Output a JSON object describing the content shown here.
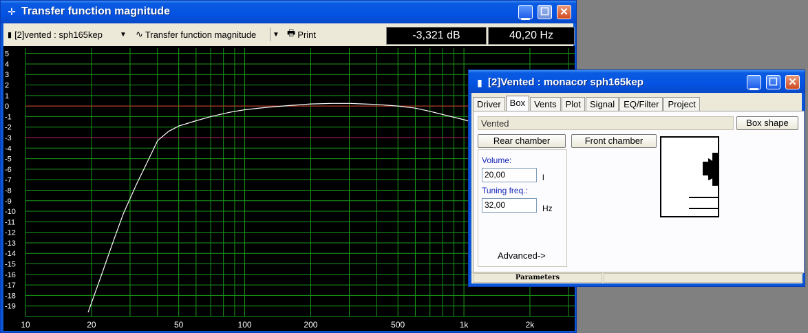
{
  "main_window": {
    "title": "Transfer function magnitude",
    "toolbar": {
      "project_selector": "[2]vented : sph165kep",
      "view_selector": "Transfer function magnitude",
      "print_label": "Print",
      "readout_db": "-3,321 dB",
      "readout_hz": "40,20 Hz"
    }
  },
  "chart_data": {
    "type": "line",
    "xscale": "log",
    "xlim": [
      10,
      3200
    ],
    "ylim": [
      -20,
      5.5
    ],
    "grid": true,
    "x_tick_labels": [
      "10",
      "20",
      "50",
      "100",
      "200",
      "500",
      "1k",
      "2k"
    ],
    "x_tick_values": [
      10,
      20,
      50,
      100,
      200,
      500,
      1000,
      2000
    ],
    "y_tick_values": [
      5,
      4,
      3,
      2,
      1,
      0,
      -1,
      -2,
      -3,
      -4,
      -5,
      -6,
      -7,
      -8,
      -9,
      -10,
      -11,
      -12,
      -13,
      -14,
      -15,
      -16,
      -17,
      -18,
      -19
    ],
    "reference_lines": [
      {
        "y": 0,
        "color": "#e03030"
      },
      {
        "y": -3,
        "color": "#b02060"
      }
    ],
    "series": [
      {
        "color": "#ffffff",
        "x": [
          19.3,
          22,
          25,
          28,
          32,
          36,
          40,
          45,
          50,
          60,
          70,
          85,
          100,
          130,
          160,
          200,
          250,
          300,
          350,
          400,
          500,
          600,
          700,
          800,
          1000,
          1200,
          1500
        ],
        "y": [
          -19.6,
          -16.3,
          -13.0,
          -10.2,
          -7.5,
          -5.3,
          -3.3,
          -2.4,
          -1.9,
          -1.4,
          -1.0,
          -0.6,
          -0.35,
          -0.1,
          0.05,
          0.2,
          0.25,
          0.25,
          0.2,
          0.15,
          0.0,
          -0.2,
          -0.5,
          -0.8,
          -1.3,
          -1.8,
          -2.3
        ]
      }
    ],
    "colors": {
      "grid": "#1a9a1a",
      "background": "#000000",
      "tick_text": "#ffffff"
    }
  },
  "project_window": {
    "title": "[2]Vented : monacor sph165kep",
    "tabs": [
      "Driver",
      "Box",
      "Vents",
      "Plot",
      "Signal",
      "EQ/Filter",
      "Project"
    ],
    "active_tab": "Box",
    "box_type": "Vented",
    "box_shape_button": "Box shape",
    "rear_chamber_button": "Rear chamber",
    "front_chamber_button": "Front chamber",
    "volume_label": "Volume:",
    "volume_value": "20,00",
    "volume_unit": "l",
    "tuning_label": "Tuning freq.:",
    "tuning_value": "32,00",
    "tuning_unit": "Hz",
    "advanced_button": "Advanced->",
    "status_parameters": "Parameters"
  }
}
